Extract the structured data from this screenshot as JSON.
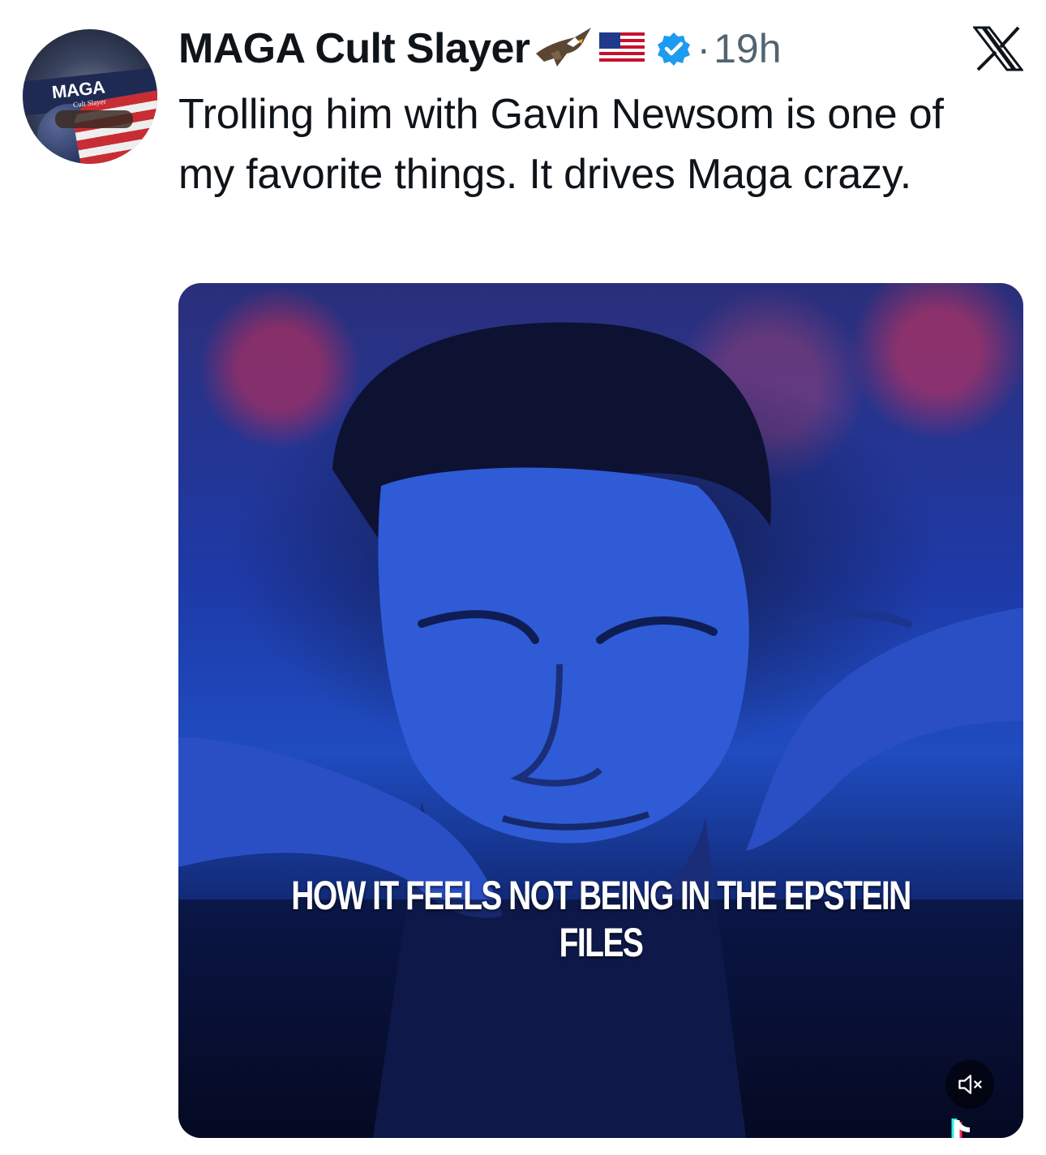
{
  "post": {
    "author_name": "MAGA Cult Slayer",
    "separator": "·",
    "time": "19h",
    "text": "Trolling him with Gavin Newsom is one of my favorite things. It drives Maga crazy."
  },
  "avatar": {
    "logo_text": "MAGA",
    "logo_sub": "Cult Slayer"
  },
  "media": {
    "caption": "HOW IT FEELS NOT BEING IN THE EPSTEIN FILES",
    "muted": true
  },
  "icons": {
    "author_emojis": [
      "eagle-icon",
      "us-flag-icon"
    ],
    "verified": "verified-badge-icon",
    "brand": "x-logo-icon",
    "mute": "speaker-muted-icon",
    "watermark": "tiktok-icon"
  },
  "colors": {
    "verified": "#1d9bf0",
    "secondary_text": "#536471",
    "primary_text": "#0f1419"
  }
}
